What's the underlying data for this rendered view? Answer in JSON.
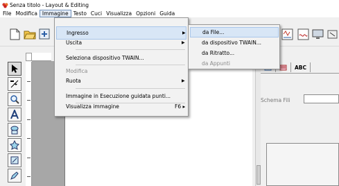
{
  "window": {
    "title": "Senza titolo - Layout & Editing",
    "app_icon": "app-logo-icon"
  },
  "menubar": {
    "items": [
      {
        "label": "File"
      },
      {
        "label": "Modifica"
      },
      {
        "label": "Immagine",
        "active": true
      },
      {
        "label": "Testo"
      },
      {
        "label": "Cuci"
      },
      {
        "label": "Visualizza"
      },
      {
        "label": "Opzioni"
      },
      {
        "label": "Guida"
      }
    ]
  },
  "toolbar": {
    "buttons": [
      "new-file-icon",
      "open-folder-icon",
      "import-icon",
      "tool-icon-1",
      "pattern-icon",
      "tool-icon-2",
      "monitor-icon",
      "tool-icon-3"
    ]
  },
  "left_tools": [
    "arrow-select-icon",
    "point-edit-icon",
    "zoom-icon",
    "text-tool-icon",
    "shape-tool-icon",
    "stamp-tool-icon",
    "embroidery-tool-icon",
    "pen-tool-icon"
  ],
  "dropdown": {
    "items": [
      {
        "label": "Ingresso",
        "submenu": true,
        "hover": true
      },
      {
        "label": "Uscita",
        "submenu": true
      },
      {
        "label": "Seleziona dispositivo TWAIN..."
      },
      {
        "label": "Modifica",
        "disabled": true
      },
      {
        "label": "Ruota",
        "submenu": true
      },
      {
        "label": "Immagine in Esecuzione guidata punti..."
      },
      {
        "label": "Visualizza immagine",
        "shortcut": "F6 ▸"
      }
    ]
  },
  "submenu": {
    "items": [
      {
        "label": "da File...",
        "hover": true
      },
      {
        "label": "da dispositivo TWAIN..."
      },
      {
        "label": "da Ritratto..."
      },
      {
        "label": "da Appunti",
        "disabled": true
      }
    ]
  },
  "right_panel": {
    "tabs": [
      "stitch-icon",
      "pattern-fill-icon",
      "ABC"
    ],
    "schema_label": "Schema Fili",
    "schema_value": ""
  },
  "colors": {
    "menu_hover": "#d8e6f6",
    "menu_hover_border": "#a9c6ea",
    "canvas_bg": "#a7a7a7"
  }
}
